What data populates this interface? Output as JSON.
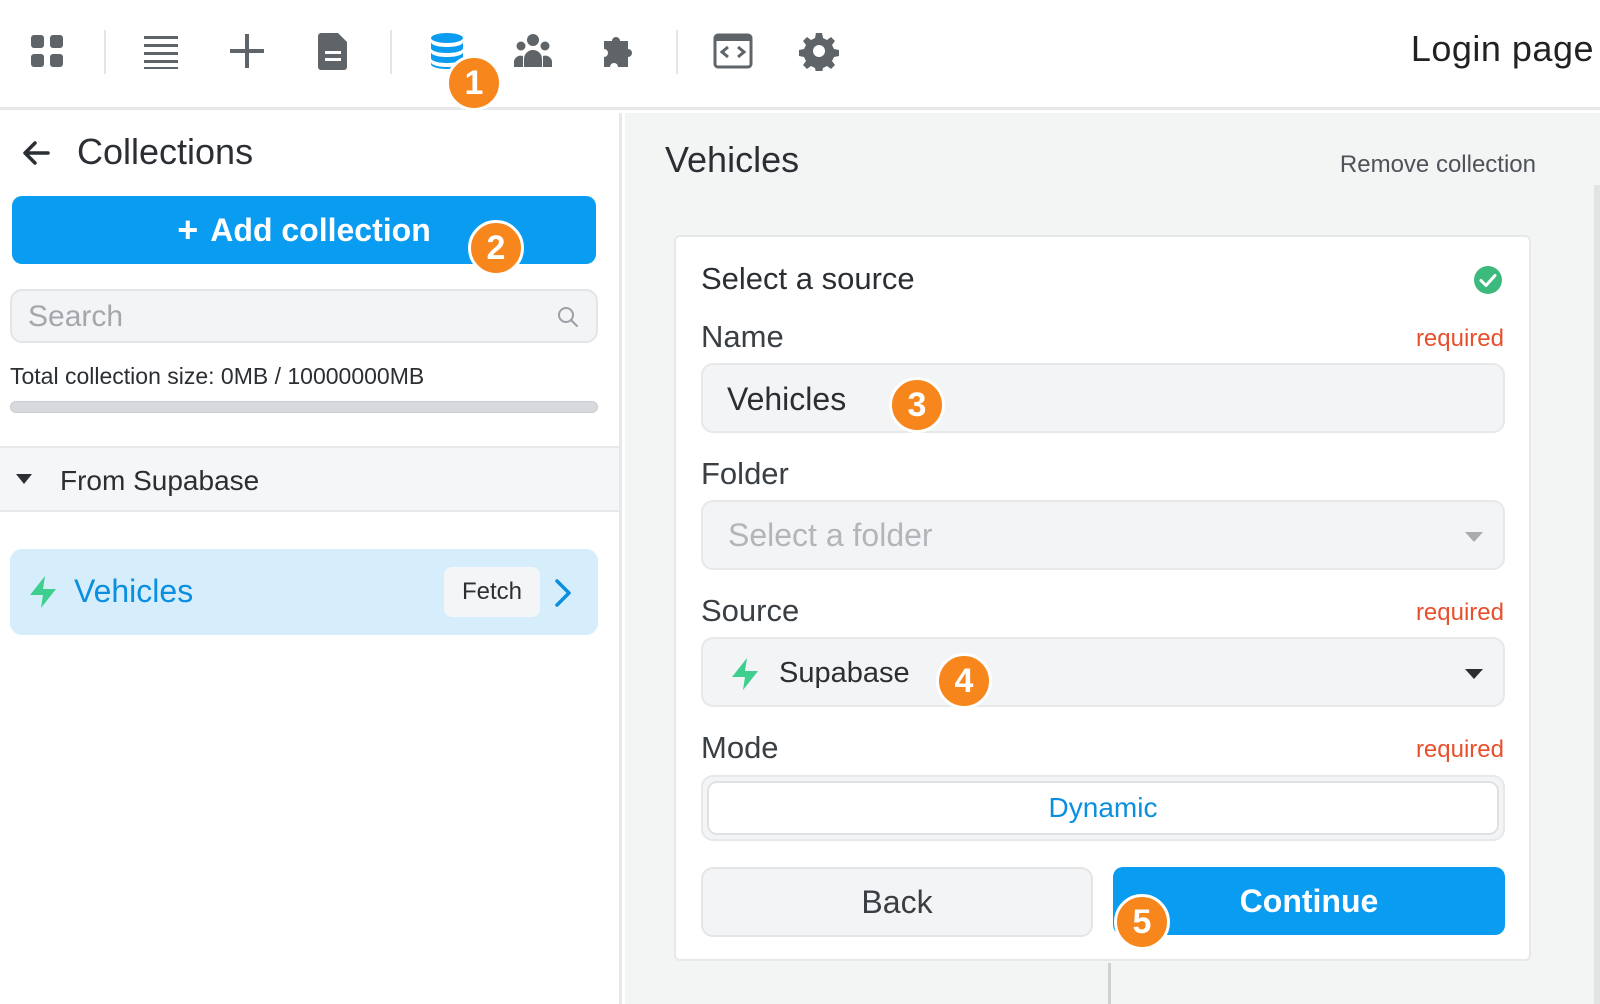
{
  "toolbar": {
    "icons": [
      "apps-grid-icon",
      "list-icon",
      "plus-icon",
      "page-icon",
      "database-icon",
      "users-icon",
      "puzzle-icon",
      "code-icon",
      "gear-icon"
    ],
    "active_icon": "database-icon",
    "page_title": "Login page"
  },
  "colors": {
    "accent": "#0a9cf0",
    "badge": "#f7861c",
    "required": "#e8502d",
    "supabase_green": "#3ecf8e",
    "selected_item_bg": "#d6edfc"
  },
  "badges": [
    "1",
    "2",
    "3",
    "4",
    "5"
  ],
  "sidebar": {
    "title": "Collections",
    "add_button_label": "Add collection",
    "search_placeholder": "Search",
    "total_size": "Total collection size: 0MB / 10000000MB",
    "size_usage": 0,
    "group_label": "From Supabase",
    "items": [
      {
        "name": "Vehicles",
        "action_label": "Fetch",
        "icon": "supabase-icon"
      }
    ]
  },
  "main": {
    "title": "Vehicles",
    "remove_label": "Remove collection",
    "card": {
      "title": "Select a source",
      "name_label": "Name",
      "name_required": "required",
      "name_value": "Vehicles",
      "folder_label": "Folder",
      "folder_placeholder": "Select a folder",
      "source_label": "Source",
      "source_required": "required",
      "source_value": "Supabase",
      "mode_label": "Mode",
      "mode_required": "required",
      "mode_value": "Dynamic",
      "back_label": "Back",
      "continue_label": "Continue"
    }
  }
}
